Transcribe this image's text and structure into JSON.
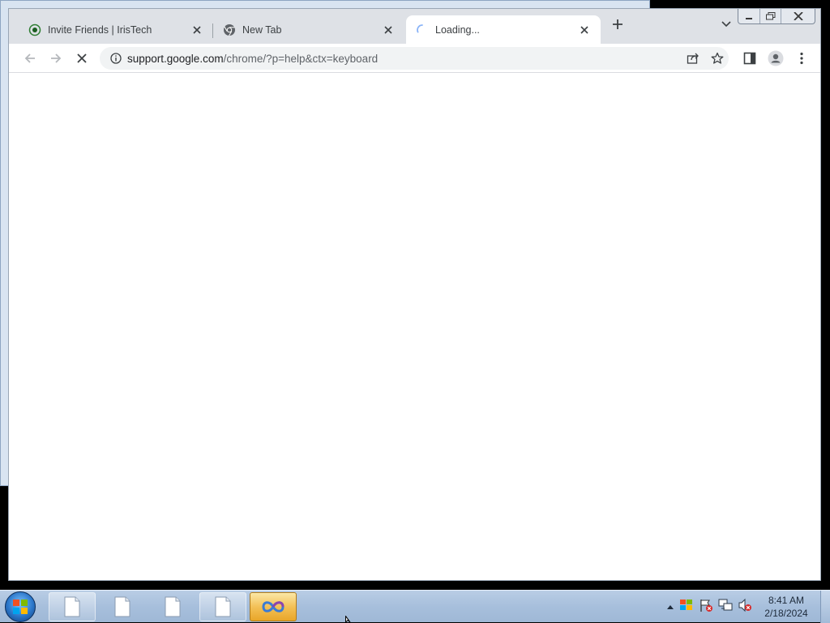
{
  "browser": {
    "tabs": [
      {
        "title": "Invite Friends | IrisTech",
        "favicon": "record-icon",
        "active": false
      },
      {
        "title": "New Tab",
        "favicon": "chrome-icon",
        "active": false
      },
      {
        "title": "Loading...",
        "favicon": "loading-spinner-icon",
        "active": true
      }
    ],
    "toolbar": {
      "url_host": "support.google.com",
      "url_path": "/chrome/?p=help&ctx=keyboard"
    }
  },
  "taskbar": {
    "clock_time": "8:41 AM",
    "clock_date": "2/18/2024",
    "buttons": [
      {
        "icon": "document-icon"
      },
      {
        "icon": "document-icon"
      },
      {
        "icon": "document-icon"
      },
      {
        "icon": "document-icon"
      },
      {
        "icon": "infinity-app-icon",
        "active": true
      }
    ]
  },
  "colors": {
    "tab_strip": "#dee1e6",
    "omnibox": "#f1f3f4",
    "taskbar": "#a7bfdc",
    "active_task": "#f3c157"
  }
}
